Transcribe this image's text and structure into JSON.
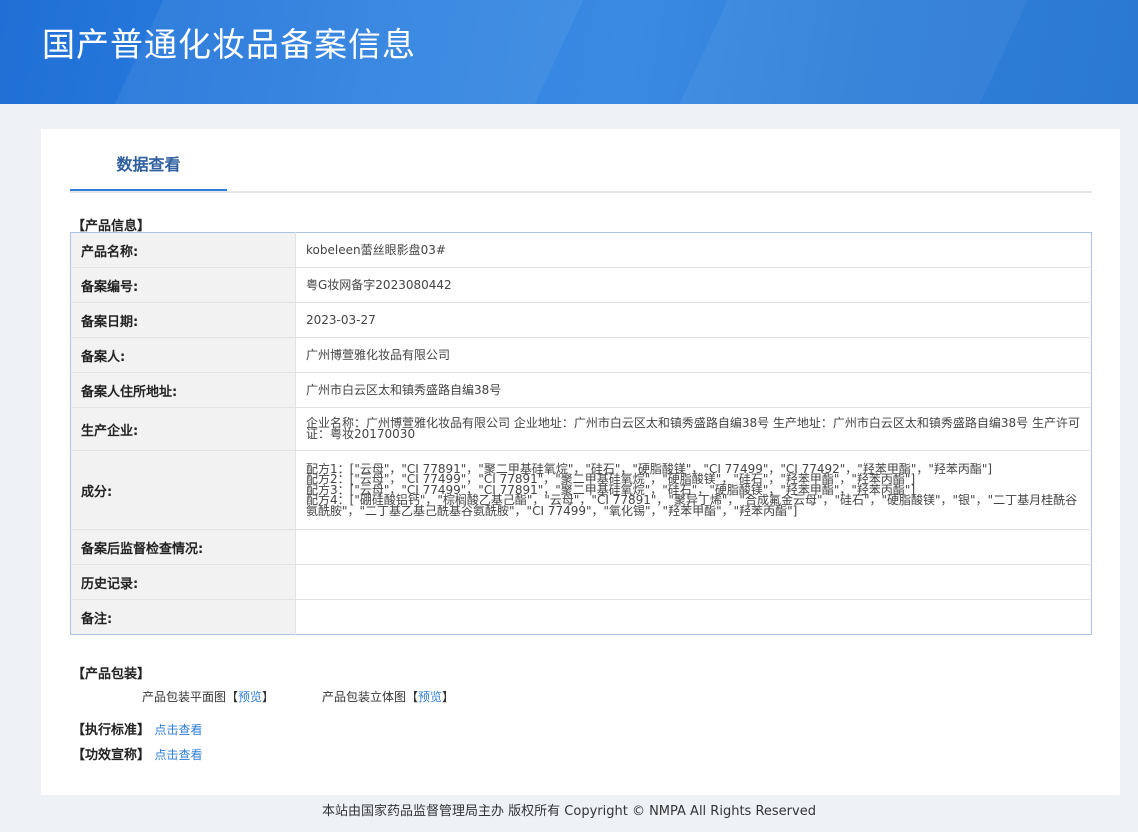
{
  "header": {
    "title": "国产普通化妆品备案信息"
  },
  "tab": {
    "label": "数据查看"
  },
  "product_info": {
    "section_label": "【产品信息】",
    "rows": [
      {
        "key": "产品名称:",
        "value": "kobeleen蕾丝眼影盘03#"
      },
      {
        "key": "备案编号:",
        "value": "粤G妆网备字2023080442"
      },
      {
        "key": "备案日期:",
        "value": "2023-03-27"
      },
      {
        "key": "备案人:",
        "value": "广州博萱雅化妆品有限公司"
      },
      {
        "key": "备案人住所地址:",
        "value": "广州市白云区太和镇秀盛路自编38号"
      },
      {
        "key": "生产企业:",
        "value": "企业名称：广州博萱雅化妆品有限公司 企业地址：广州市白云区太和镇秀盛路自编38号 生产地址：广州市白云区太和镇秀盛路自编38号 生产许可证：粤妆20170030"
      },
      {
        "key": "成分:",
        "value": "配方1：[\"云母\"，\"CI 77891\"，\"聚二甲基硅氧烷\"，\"硅石\"，\"硬脂酸镁\"，\"CI 77499\"，\"CI 77492\"，\"羟苯甲酯\"，\"羟苯丙酯\"]\n配方2：[\"云母\"，\"CI 77499\"，\"CI 77891\"，\"聚二甲基硅氧烷\"，\"硬脂酸镁\"，\"硅石\"，\"羟苯甲酯\"，\"羟苯丙酯\"]\n配方3：[\"云母\"，\"CI 77499\"，\"CI 77891\"，\"聚二甲基硅氧烷\"，\"硅石\"，\"硬脂酸镁\"，\"羟苯甲酯\"，\"羟苯丙酯\"]\n配方4：[\"硼硅酸铝钙\"，\"棕榈酸乙基己酯\"，\"云母\"，\"CI 77891\"，\"聚异丁烯\"，\"合成氟金云母\"，\"硅石\"，\"硬脂酸镁\"，\"银\"，\"二丁基月桂酰谷氨酰胺\"，\"二丁基乙基己酰基谷氨酰胺\"，\"CI 77499\"，\"氧化锡\"，\"羟苯甲酯\"，\"羟苯丙酯\"]"
      },
      {
        "key": "备案后监督检查情况:",
        "value": ""
      },
      {
        "key": "历史记录:",
        "value": ""
      },
      {
        "key": "备注:",
        "value": ""
      }
    ]
  },
  "packaging": {
    "section_label": "【产品包装】",
    "flat_label": "产品包装平面图",
    "solid_label": "产品包装立体图",
    "bracket_open": "【",
    "bracket_close": "】",
    "preview_link": "预览"
  },
  "standard": {
    "label": "【执行标准】",
    "link": "点击查看"
  },
  "efficacy": {
    "label": "【功效宣称】",
    "link": "点击查看"
  },
  "footer": {
    "text": "本站由国家药品监督管理局主办 版权所有 Copyright © NMPA All Rights Reserved"
  },
  "colors": {
    "header_blue": "#2f7fd9",
    "link_blue": "#2f7fd9",
    "tab_text": "#2f5f9e"
  }
}
